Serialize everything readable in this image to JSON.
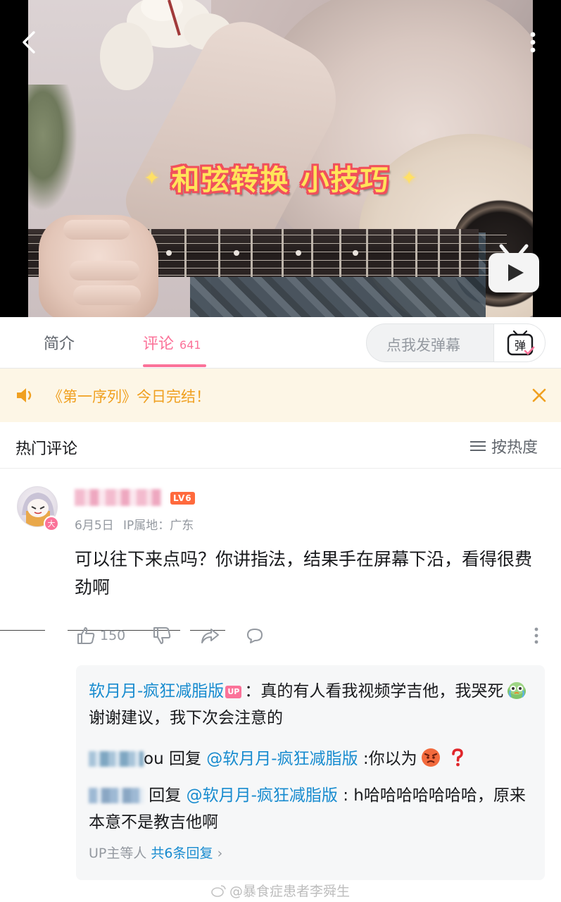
{
  "video": {
    "overlay_title_a": "和弦转换",
    "overlay_title_b": "小技巧",
    "spark": "✦"
  },
  "tabs": {
    "intro": "简介",
    "comments": "评论",
    "comments_count": "641",
    "danmu_placeholder": "点我发弹幕",
    "danmu_icon_glyph": "弹"
  },
  "notice": {
    "text": "《第一序列》今日完结！"
  },
  "section": {
    "title": "热门评论",
    "sort_label": "按热度"
  },
  "comment": {
    "level": "LV6",
    "badge": "大",
    "date": "6月5日",
    "ip": "IP属地：广东",
    "text": "可以往下来点吗？你讲指法，结果手在屏幕下沿，看得很费劲啊",
    "likes": "150"
  },
  "replies": {
    "r1_author": "软月月-疯狂减脂版",
    "r1_up": "UP",
    "r1_text_a": "：真的有人看我视频学吉他，我哭死",
    "r1_text_b": "谢谢建议，我下次会注意的",
    "r2_name_tail": "ou",
    "r2_reply_word": " 回复 ",
    "r2_mention": "@软月月-疯狂减脂版",
    "r2_text": " :你以为",
    "r3_reply_word": " 回复 ",
    "r3_mention": "@软月月-疯狂减脂版",
    "r3_text": " : h哈哈哈哈哈哈哈，原来本意不是教吉他啊",
    "more_prefix": "UP主等人",
    "more_total": "共6条回复",
    "more_chevron": "›"
  },
  "watermark": "@暴食症患者李舜生",
  "colors": {
    "accent_pink": "#fb7299",
    "link_blue": "#178bcf",
    "notice_orange": "#f0a020",
    "notice_bg": "#fdf6e6"
  }
}
